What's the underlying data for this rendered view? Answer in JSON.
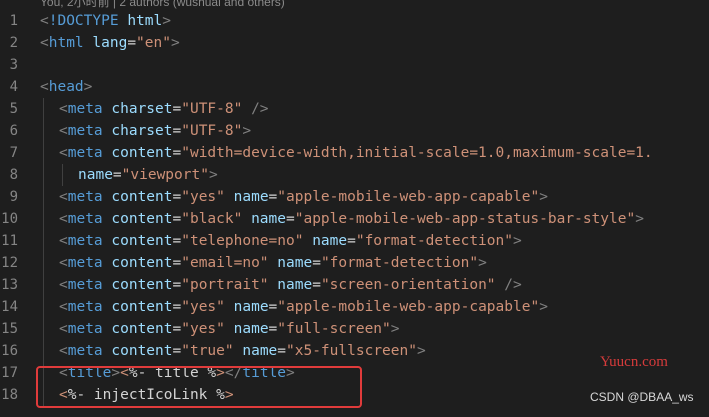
{
  "codelens": "You, 2小时前 | 2 authors (wushuai and others)",
  "lines": [
    {
      "num": "1",
      "tokens": [
        [
          "punc",
          "<"
        ],
        [
          "tag",
          "!DOCTYPE"
        ],
        [
          "ejs",
          " "
        ],
        [
          "attr",
          "html"
        ],
        [
          "punc",
          ">"
        ]
      ]
    },
    {
      "num": "2",
      "tokens": [
        [
          "punc",
          "<"
        ],
        [
          "tag",
          "html"
        ],
        [
          "ejs",
          " "
        ],
        [
          "attr",
          "lang"
        ],
        [
          "ejs",
          "="
        ],
        [
          "str",
          "\"en\""
        ],
        [
          "punc",
          ">"
        ]
      ]
    },
    {
      "num": "3",
      "tokens": []
    },
    {
      "num": "4",
      "tokens": [
        [
          "punc",
          "<"
        ],
        [
          "tag",
          "head"
        ],
        [
          "punc",
          ">"
        ]
      ]
    },
    {
      "num": "5",
      "indent": 1,
      "tokens": [
        [
          "punc",
          "<"
        ],
        [
          "tag",
          "meta"
        ],
        [
          "ejs",
          " "
        ],
        [
          "attr",
          "charset"
        ],
        [
          "ejs",
          "="
        ],
        [
          "str",
          "\"UTF-8\""
        ],
        [
          "ejs",
          " "
        ],
        [
          "punc",
          "/>"
        ]
      ]
    },
    {
      "num": "6",
      "indent": 1,
      "tokens": [
        [
          "punc",
          "<"
        ],
        [
          "tag",
          "meta"
        ],
        [
          "ejs",
          " "
        ],
        [
          "attr",
          "charset"
        ],
        [
          "ejs",
          "="
        ],
        [
          "str",
          "\"UTF-8\""
        ],
        [
          "punc",
          ">"
        ]
      ]
    },
    {
      "num": "7",
      "indent": 1,
      "tokens": [
        [
          "punc",
          "<"
        ],
        [
          "tag",
          "meta"
        ],
        [
          "ejs",
          " "
        ],
        [
          "attr",
          "content"
        ],
        [
          "ejs",
          "="
        ],
        [
          "str",
          "\"width=device-width,initial-scale=1.0,maximum-scale=1."
        ]
      ]
    },
    {
      "num": "8",
      "indent": 2,
      "tokens": [
        [
          "attr",
          "name"
        ],
        [
          "ejs",
          "="
        ],
        [
          "str",
          "\"viewport\""
        ],
        [
          "punc",
          ">"
        ]
      ]
    },
    {
      "num": "9",
      "indent": 1,
      "tokens": [
        [
          "punc",
          "<"
        ],
        [
          "tag",
          "meta"
        ],
        [
          "ejs",
          " "
        ],
        [
          "attr",
          "content"
        ],
        [
          "ejs",
          "="
        ],
        [
          "str",
          "\"yes\""
        ],
        [
          "ejs",
          " "
        ],
        [
          "attr",
          "name"
        ],
        [
          "ejs",
          "="
        ],
        [
          "str",
          "\"apple-mobile-web-app-capable\""
        ],
        [
          "punc",
          ">"
        ]
      ]
    },
    {
      "num": "10",
      "indent": 1,
      "tokens": [
        [
          "punc",
          "<"
        ],
        [
          "tag",
          "meta"
        ],
        [
          "ejs",
          " "
        ],
        [
          "attr",
          "content"
        ],
        [
          "ejs",
          "="
        ],
        [
          "str",
          "\"black\""
        ],
        [
          "ejs",
          " "
        ],
        [
          "attr",
          "name"
        ],
        [
          "ejs",
          "="
        ],
        [
          "str",
          "\"apple-mobile-web-app-status-bar-style\""
        ],
        [
          "punc",
          ">"
        ]
      ]
    },
    {
      "num": "11",
      "indent": 1,
      "tokens": [
        [
          "punc",
          "<"
        ],
        [
          "tag",
          "meta"
        ],
        [
          "ejs",
          " "
        ],
        [
          "attr",
          "content"
        ],
        [
          "ejs",
          "="
        ],
        [
          "str",
          "\"telephone=no\""
        ],
        [
          "ejs",
          " "
        ],
        [
          "attr",
          "name"
        ],
        [
          "ejs",
          "="
        ],
        [
          "str",
          "\"format-detection\""
        ],
        [
          "punc",
          ">"
        ]
      ]
    },
    {
      "num": "12",
      "indent": 1,
      "tokens": [
        [
          "punc",
          "<"
        ],
        [
          "tag",
          "meta"
        ],
        [
          "ejs",
          " "
        ],
        [
          "attr",
          "content"
        ],
        [
          "ejs",
          "="
        ],
        [
          "str",
          "\"email=no\""
        ],
        [
          "ejs",
          " "
        ],
        [
          "attr",
          "name"
        ],
        [
          "ejs",
          "="
        ],
        [
          "str",
          "\"format-detection\""
        ],
        [
          "punc",
          ">"
        ]
      ]
    },
    {
      "num": "13",
      "indent": 1,
      "tokens": [
        [
          "punc",
          "<"
        ],
        [
          "tag",
          "meta"
        ],
        [
          "ejs",
          " "
        ],
        [
          "attr",
          "content"
        ],
        [
          "ejs",
          "="
        ],
        [
          "str",
          "\"portrait\""
        ],
        [
          "ejs",
          " "
        ],
        [
          "attr",
          "name"
        ],
        [
          "ejs",
          "="
        ],
        [
          "str",
          "\"screen-orientation\""
        ],
        [
          "ejs",
          " "
        ],
        [
          "punc",
          "/>"
        ]
      ]
    },
    {
      "num": "14",
      "indent": 1,
      "tokens": [
        [
          "punc",
          "<"
        ],
        [
          "tag",
          "meta"
        ],
        [
          "ejs",
          " "
        ],
        [
          "attr",
          "content"
        ],
        [
          "ejs",
          "="
        ],
        [
          "str",
          "\"yes\""
        ],
        [
          "ejs",
          " "
        ],
        [
          "attr",
          "name"
        ],
        [
          "ejs",
          "="
        ],
        [
          "str",
          "\"apple-mobile-web-app-capable\""
        ],
        [
          "punc",
          ">"
        ]
      ]
    },
    {
      "num": "15",
      "indent": 1,
      "tokens": [
        [
          "punc",
          "<"
        ],
        [
          "tag",
          "meta"
        ],
        [
          "ejs",
          " "
        ],
        [
          "attr",
          "content"
        ],
        [
          "ejs",
          "="
        ],
        [
          "str",
          "\"yes\""
        ],
        [
          "ejs",
          " "
        ],
        [
          "attr",
          "name"
        ],
        [
          "ejs",
          "="
        ],
        [
          "str",
          "\"full-screen\""
        ],
        [
          "punc",
          ">"
        ]
      ]
    },
    {
      "num": "16",
      "indent": 1,
      "tokens": [
        [
          "punc",
          "<"
        ],
        [
          "tag",
          "meta"
        ],
        [
          "ejs",
          " "
        ],
        [
          "attr",
          "content"
        ],
        [
          "ejs",
          "="
        ],
        [
          "str",
          "\"true\""
        ],
        [
          "ejs",
          " "
        ],
        [
          "attr",
          "name"
        ],
        [
          "ejs",
          "="
        ],
        [
          "str",
          "\"x5-fullscreen\""
        ],
        [
          "punc",
          ">"
        ]
      ]
    },
    {
      "num": "17",
      "indent": 1,
      "tokens": [
        [
          "punc",
          "<"
        ],
        [
          "tag",
          "title"
        ],
        [
          "punc",
          ">"
        ],
        [
          "ejsd",
          "<"
        ],
        [
          "ejs",
          "%- title %"
        ],
        [
          "ejsd",
          ">"
        ],
        [
          "punc",
          "</"
        ],
        [
          "tag",
          "title"
        ],
        [
          "punc",
          ">"
        ]
      ]
    },
    {
      "num": "18",
      "indent": 1,
      "tokens": [
        [
          "ejsd",
          "<"
        ],
        [
          "ejs",
          "%- injectIcoLink %"
        ],
        [
          "ejsd",
          ">"
        ]
      ]
    }
  ],
  "watermark_site": "Yuucn.com",
  "watermark_author": "CSDN @DBAA_ws"
}
